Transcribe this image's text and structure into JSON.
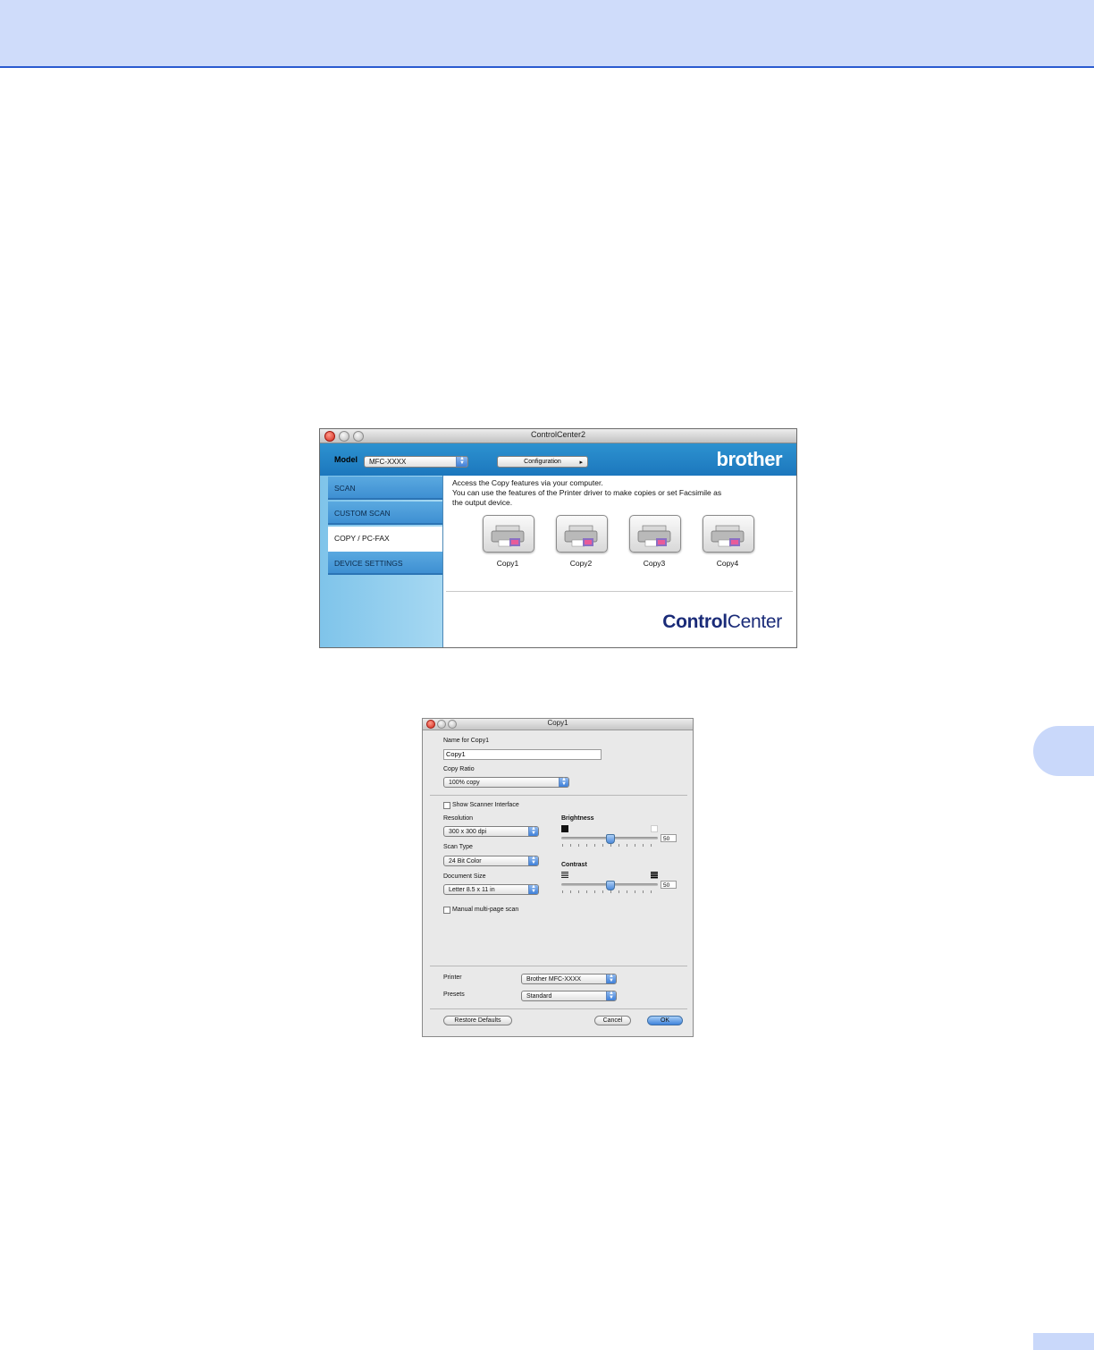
{
  "controlcenter": {
    "window_title": "ControlCenter2",
    "model_label": "Model",
    "model_value": "MFC-XXXX",
    "configuration_label": "Configuration",
    "brand": "brother",
    "nav": [
      {
        "label": "SCAN"
      },
      {
        "label": "CUSTOM SCAN"
      },
      {
        "label": "COPY / PC-FAX"
      },
      {
        "label": "DEVICE SETTINGS"
      }
    ],
    "active_nav": "COPY / PC-FAX",
    "intro_line1": "Access the Copy features via your computer.",
    "intro_line2": "You can use the features of the Printer driver to make copies or set Facsimile as",
    "intro_line3": "the output device.",
    "copy_buttons": [
      {
        "label": "Copy1",
        "icon": "printer-icon"
      },
      {
        "label": "Copy2",
        "icon": "printer-icon"
      },
      {
        "label": "Copy3",
        "icon": "printer-icon"
      },
      {
        "label": "Copy4",
        "icon": "printer-icon"
      }
    ],
    "logo_bold": "Control",
    "logo_regular": "Center"
  },
  "copy_dialog": {
    "title": "Copy1",
    "name_label": "Name for Copy1",
    "name_value": "Copy1",
    "copy_ratio_label": "Copy Ratio",
    "copy_ratio_value": "100% copy",
    "show_scanner_interface": "Show Scanner Interface",
    "resolution_label": "Resolution",
    "resolution_value": "300 x 300 dpi",
    "scan_type_label": "Scan Type",
    "scan_type_value": "24 Bit Color",
    "document_size_label": "Document Size",
    "document_size_value": "Letter  8.5 x 11 in",
    "brightness_label": "Brightness",
    "brightness_value": "50",
    "contrast_label": "Contrast",
    "contrast_value": "50",
    "manual_multipage": "Manual multi-page scan",
    "printer_label": "Printer",
    "printer_value": "Brother MFC-XXXX",
    "presets_label": "Presets",
    "presets_value": "Standard",
    "restore_defaults": "Restore Defaults",
    "cancel": "Cancel",
    "ok": "OK"
  },
  "colors": {
    "header_band": "#cfdcfa",
    "cc_header_blue": "#1c77bd",
    "accent_blue": "#3f83db"
  }
}
